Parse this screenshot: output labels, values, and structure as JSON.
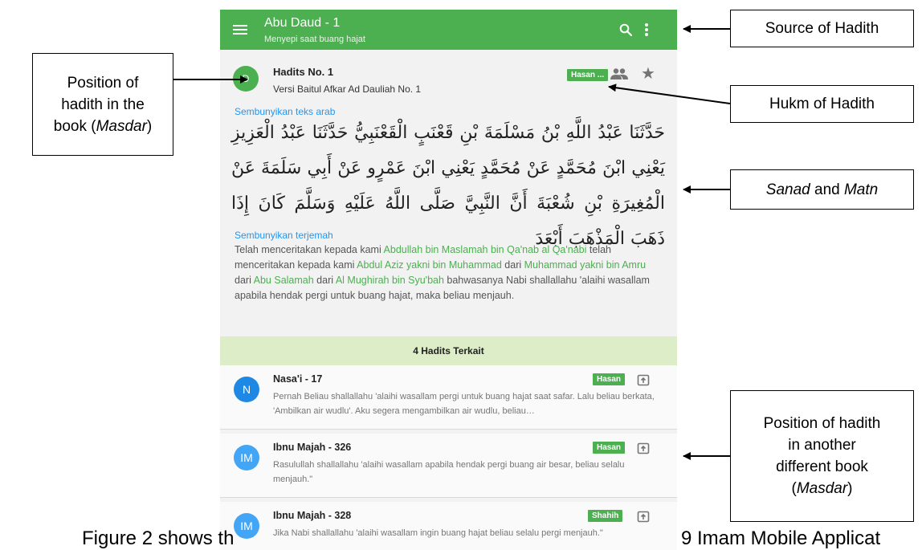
{
  "app_bar": {
    "title": "Abu Daud - 1",
    "subtitle": "Menyepi saat buang hajat",
    "menu_icon": "hamburger-menu-icon",
    "search_icon": "search-icon",
    "more_icon": "more-vert-icon"
  },
  "hadith": {
    "avatar_letter": "D",
    "title": "Hadits No. 1",
    "version": "Versi Baitul Afkar Ad Dauliah No. 1",
    "grade": "Hasan ...",
    "narrators_icon": "people-icon",
    "favorite_icon": "star-icon",
    "toggle_arabic": "Sembunyikan teks arab",
    "arabic_text": "حَدَّثَنَا عَبْدُ اللَّهِ بْنُ مَسْلَمَةَ بْنِ قَعْنَبٍ الْقَعْنَبِيُّ حَدَّثَنَا عَبْدُ الْعَزِيزِ يَعْنِي ابْنَ مُحَمَّدٍ عَنْ مُحَمَّدٍ يَعْنِي ابْنَ عَمْرٍو عَنْ أَبِي سَلَمَةَ عَنْ الْمُغِيرَةِ بْنِ شُعْبَةَ أَنَّ النَّبِيَّ صَلَّى اللَّهُ عَلَيْهِ وَسَلَّمَ كَانَ إِذَا ذَهَبَ الْمَذْهَبَ أَبْعَدَ",
    "toggle_translation": "Sembunyikan terjemah",
    "translation": {
      "t1": "Telah menceritakan kepada kami ",
      "n1": "Abdullah bin Maslamah bin Qa'nab al Qa'nabi",
      "t2": " telah menceritakan kepada kami ",
      "n2": "Abdul Aziz yakni bin Muhammad",
      "t3": " dari ",
      "n3": "Muhammad yakni bin Amru",
      "t4": " dari ",
      "n4": "Abu Salamah",
      "t5": " dari ",
      "n5": "Al Mughirah bin Syu'bah",
      "t6": " bahwasanya Nabi shallallahu 'alaihi wasallam apabila hendak pergi untuk buang hajat, maka beliau menjauh."
    }
  },
  "related": {
    "header": "4 Hadits Terkait",
    "open_icon": "open-in-new-icon",
    "items": [
      {
        "avatar": "N",
        "avatar_color": "#1e88e5",
        "title": "Nasa'i - 17",
        "grade": "Hasan",
        "text": "Pernah Beliau shallallahu 'alaihi wasallam pergi untuk buang hajat saat safar. Lalu beliau berkata, 'Ambilkan air wudlu'. Aku segera mengambilkan air wudlu, beliau…"
      },
      {
        "avatar": "IM",
        "avatar_color": "#42a5f5",
        "title": "Ibnu Majah - 326",
        "grade": "Hasan",
        "text": "Rasulullah shallallahu 'alaihi wasallam apabila hendak pergi buang air besar, beliau selalu menjauh.\""
      },
      {
        "avatar": "IM",
        "avatar_color": "#42a5f5",
        "title": "Ibnu Majah - 328",
        "grade": "Shahih",
        "text": "Jika Nabi shallallahu 'alaihi wasallam ingin buang hajat beliau selalu pergi menjauh.\""
      }
    ]
  },
  "annotations": {
    "source": "Source of Hadith",
    "position_line1": "Position of",
    "position_line2": "hadith in the",
    "position_line3_pre": "book (",
    "position_line3_em": "Masdar",
    "position_line3_post": ")",
    "hukm": "Hukm of Hadith",
    "sanad": "Sanad",
    "and": " and ",
    "matn": "Matn",
    "other_line1": "Position of hadith",
    "other_line2": "in another",
    "other_line3": "different book",
    "other_line4_pre": "(",
    "other_line4_em": "Masdar",
    "other_line4_post": ")"
  },
  "caption": {
    "left": "Figure 2 shows th",
    "right": "9 Imam Mobile Applicat"
  }
}
